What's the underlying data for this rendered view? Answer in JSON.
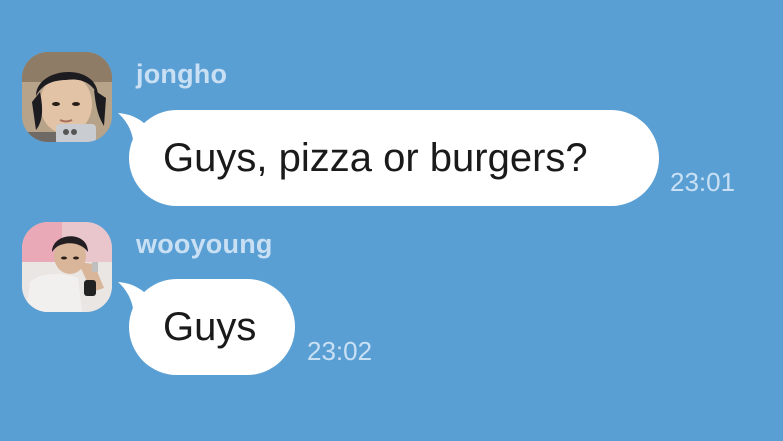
{
  "messages": [
    {
      "sender": "jongho",
      "text": "Guys, pizza or burgers?",
      "time": "23:01",
      "avatar_icon": "profile-photo-jongho"
    },
    {
      "sender": "wooyoung",
      "text": "Guys",
      "time": "23:02",
      "avatar_icon": "profile-photo-wooyoung"
    }
  ],
  "colors": {
    "background": "#5a9fd4",
    "bubble": "#ffffff",
    "meta_text": "#c9e0f4",
    "message_text": "#1a1a1a"
  }
}
